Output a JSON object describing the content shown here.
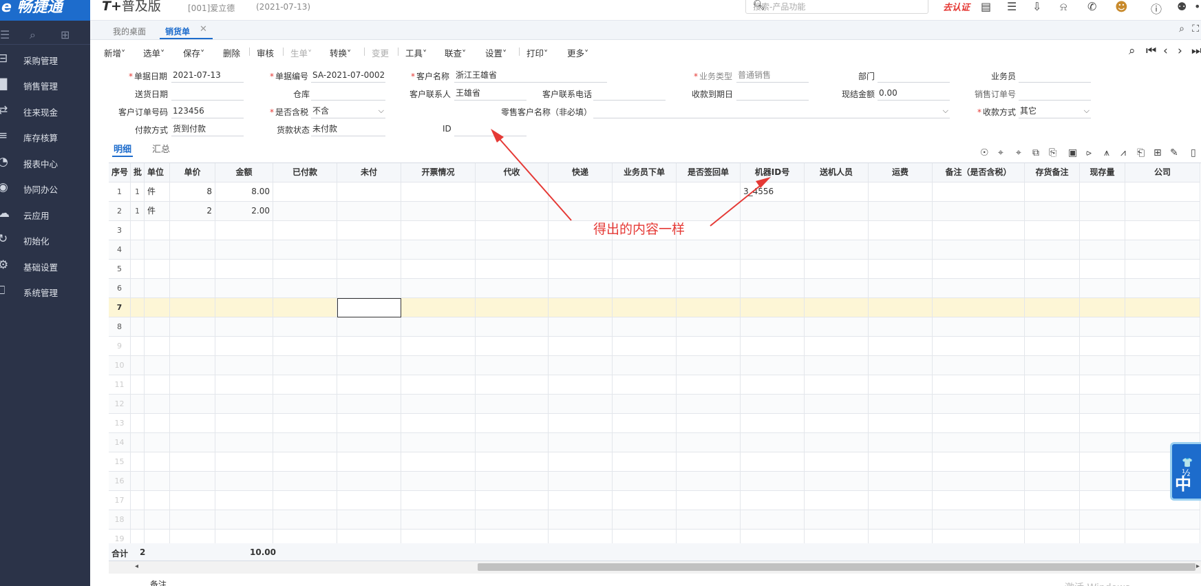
{
  "topbar": {
    "logo": "e 畅捷通",
    "edition": "普及版",
    "edition_prefix": "T+",
    "account": "[001]爱立德",
    "account_date": "(2021-07-13)",
    "search_placeholder": "搜索-产品功能",
    "certify": "去认证"
  },
  "sidebar": {
    "items": [
      {
        "label": "采购管理",
        "icon": "cart-icon"
      },
      {
        "label": "销售管理",
        "icon": "chart-icon"
      },
      {
        "label": "往来现金",
        "icon": "exchange-icon"
      },
      {
        "label": "库存核算",
        "icon": "warehouse-icon"
      },
      {
        "label": "报表中心",
        "icon": "pie-icon"
      },
      {
        "label": "协同办公",
        "icon": "target-icon"
      },
      {
        "label": "云应用",
        "icon": "cloud-icon"
      },
      {
        "label": "初始化",
        "icon": "refresh-icon"
      },
      {
        "label": "基础设置",
        "icon": "settings-icon"
      },
      {
        "label": "系统管理",
        "icon": "monitor-icon"
      }
    ]
  },
  "tabs": {
    "home": "我的桌面",
    "sales": "销货单"
  },
  "toolbar": {
    "items": [
      {
        "label": "新增˅",
        "disabled": false
      },
      {
        "label": "选单˅",
        "disabled": false
      },
      {
        "label": "保存˅",
        "disabled": false
      },
      {
        "label": "删除",
        "disabled": false
      },
      {
        "label": "审核",
        "disabled": false
      },
      {
        "label": "生单˅",
        "disabled": true
      },
      {
        "label": "转换˅",
        "disabled": false
      },
      {
        "label": "变更",
        "disabled": true
      },
      {
        "label": "工具˅",
        "disabled": false
      },
      {
        "label": "联查˅",
        "disabled": false
      },
      {
        "label": "设置˅",
        "disabled": false
      },
      {
        "label": "打印˅",
        "disabled": false
      },
      {
        "label": "更多˅",
        "disabled": false
      }
    ]
  },
  "form": {
    "doc_date_label": "单据日期",
    "doc_date": "2021-07-13",
    "doc_no_label": "单据编号",
    "doc_no": "SA-2021-07-0002",
    "customer_label": "客户名称",
    "customer": "浙江王雄省",
    "biz_type_label": "业务类型",
    "biz_type": "普通销售",
    "dept_label": "部门",
    "dept": "",
    "salesman_label": "业务员",
    "salesman": "",
    "delivery_date_label": "送货日期",
    "delivery_date": "",
    "warehouse_label": "仓库",
    "warehouse": "",
    "contact_label": "客户联系人",
    "contact": "王雄省",
    "phone_label": "客户联系电话",
    "phone": "",
    "due_date_label": "收款到期日",
    "due_date": "",
    "cash_label": "现结金额",
    "cash": "0.00",
    "sales_order_label": "销售订单号",
    "sales_order": "",
    "cust_order_label": "客户订单号码",
    "cust_order": "123456",
    "tax_label": "是否含税",
    "tax": "不含",
    "retail_label": "零售客户名称（非必填）",
    "retail": "",
    "pay_method_label": "收款方式",
    "pay_method": "其它",
    "pay_type_label": "付款方式",
    "pay_type": "货到付款",
    "pay_status_label": "货款状态",
    "pay_status": "未付款",
    "id_label": "ID",
    "id": ""
  },
  "detail_tabs": {
    "detail": "明细",
    "summary": "汇总"
  },
  "grid": {
    "columns": [
      "序号",
      "批",
      "单位",
      "单价",
      "金额",
      "已付款",
      "未付",
      "开票情况",
      "代收",
      "快递",
      "业务员下单",
      "是否签回单",
      "机器ID号",
      "送机人员",
      "运费",
      "备注（是否含税）",
      "存货备注",
      "现存量",
      "公司"
    ],
    "rows": [
      {
        "no": "1",
        "qty": "1",
        "unit": "件",
        "price": "8",
        "amount": "8.00",
        "machine_id": "3_4556"
      },
      {
        "no": "2",
        "qty": "1",
        "unit": "件",
        "price": "2",
        "amount": "2.00",
        "machine_id": ""
      }
    ],
    "empty_rows": [
      "3",
      "4",
      "5",
      "6",
      "7",
      "8",
      "9",
      "10",
      "11",
      "12",
      "13",
      "14",
      "15",
      "16",
      "17",
      "18",
      "19"
    ],
    "total_label": "合计",
    "total_qty": "2",
    "total_amount": "10.00"
  },
  "footer": {
    "remark_label": "备注",
    "watermark": "激活 Windows"
  },
  "annotation": {
    "text": "得出的内容一样",
    "color": "#e53935"
  },
  "widget": {
    "line1": "👕 ½",
    "line2": "中"
  }
}
